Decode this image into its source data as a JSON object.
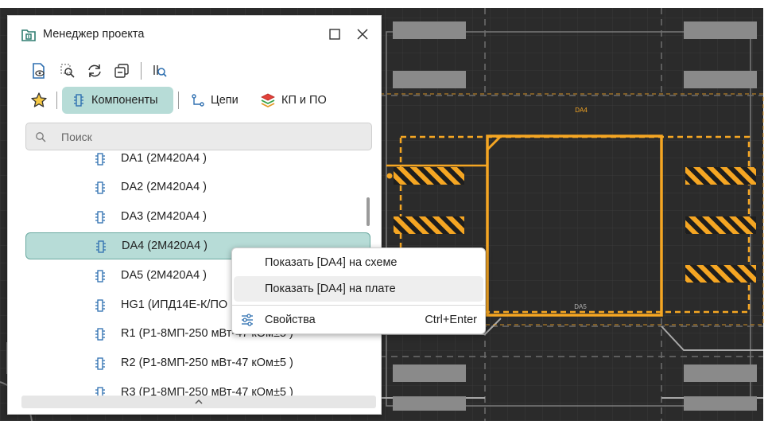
{
  "window": {
    "title": "Менеджер проекта",
    "icons": {
      "app": "project-manager-icon",
      "maximize": "maximize-icon",
      "close": "close-icon"
    }
  },
  "toolbar": {
    "buttons": [
      "show-on-schematic-icon",
      "zoom-fit-icon",
      "refresh-icon",
      "collapse-all-icon",
      "zoom-component-icon"
    ]
  },
  "tabs": [
    {
      "label": "Компоненты",
      "icon": "component-icon",
      "active": true
    },
    {
      "label": "Цепи",
      "icon": "net-icon",
      "active": false
    },
    {
      "label": "КП и ПО",
      "icon": "pads-layers-icon",
      "active": false
    }
  ],
  "search": {
    "placeholder": "Поиск"
  },
  "list": {
    "items": [
      {
        "label": "DA1 (2М420А4 )"
      },
      {
        "label": "DA2 (2М420А4 )"
      },
      {
        "label": "DA3 (2М420А4 )"
      },
      {
        "label": "DA4 (2М420А4 )",
        "selected": true
      },
      {
        "label": "DA5 (2М420А4 )"
      },
      {
        "label": "HG1 (ИПД14Е-К/ПО"
      },
      {
        "label": "R1 (Р1-8МП-250 мВт-47 кОм±5 )"
      },
      {
        "label": "R2 (Р1-8МП-250 мВт-47 кОм±5 )"
      },
      {
        "label": "R3 (Р1-8МП-250 мВт-47 кОм±5 )"
      }
    ]
  },
  "context_menu": {
    "items": [
      {
        "label": "Показать [DA4] на схеме"
      },
      {
        "label": "Показать [DA4] на плате"
      },
      {
        "label": "Свойства",
        "shortcut": "Ctrl+Enter",
        "icon": "settings-sliders-icon"
      }
    ]
  },
  "pcb": {
    "labels": {
      "top": "DA4",
      "bottom": "DA5"
    },
    "colors": {
      "background": "#2b2b2b",
      "grid": "#3a3a3a",
      "highlight": "#f5a623",
      "pad": "#8a8a8a",
      "trace": "#a8a8a8"
    }
  },
  "colors": {
    "accent": "#b7dcd7",
    "accent_border": "#6aa9a0"
  }
}
